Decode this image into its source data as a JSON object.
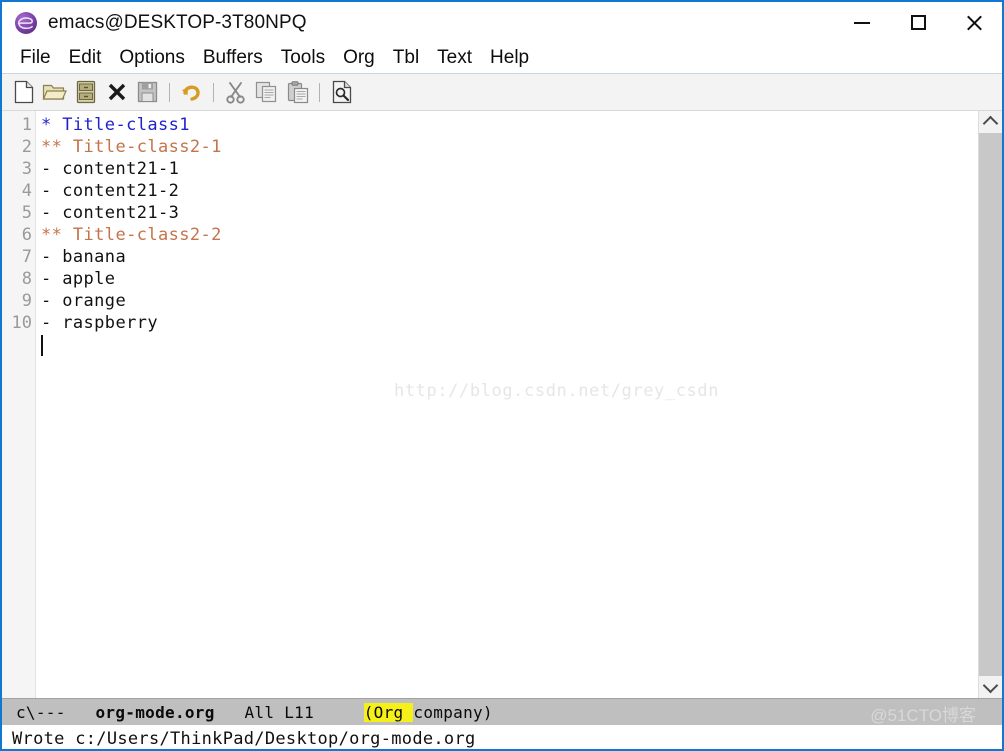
{
  "window": {
    "title": "emacs@DESKTOP-3T80NPQ",
    "app_icon": "emacs-logo-icon",
    "border_color": "#1277d0",
    "controls": {
      "minimize": "–",
      "maximize": "□",
      "close": "✕"
    }
  },
  "menubar": {
    "items": [
      {
        "label": "File"
      },
      {
        "label": "Edit"
      },
      {
        "label": "Options"
      },
      {
        "label": "Buffers"
      },
      {
        "label": "Tools"
      },
      {
        "label": "Org"
      },
      {
        "label": "Tbl"
      },
      {
        "label": "Text"
      },
      {
        "label": "Help"
      }
    ]
  },
  "toolbar": {
    "buttons": [
      {
        "name": "new-file-icon",
        "title": "New File",
        "enabled": true
      },
      {
        "name": "open-file-icon",
        "title": "Open File",
        "enabled": true
      },
      {
        "name": "save-buffer-icon",
        "title": "Save Buffer",
        "enabled": true
      },
      {
        "name": "close-buffer-icon",
        "title": "Close Buffer",
        "enabled": true
      },
      {
        "name": "save-disk-icon",
        "title": "Save",
        "enabled": false
      },
      {
        "name": "separator"
      },
      {
        "name": "undo-icon",
        "title": "Undo",
        "enabled": true
      },
      {
        "name": "separator"
      },
      {
        "name": "cut-icon",
        "title": "Cut",
        "enabled": true
      },
      {
        "name": "copy-icon",
        "title": "Copy",
        "enabled": true
      },
      {
        "name": "paste-icon",
        "title": "Paste",
        "enabled": true
      },
      {
        "name": "separator"
      },
      {
        "name": "search-icon",
        "title": "Search",
        "enabled": true
      }
    ]
  },
  "editor": {
    "line_numbers": [
      "1",
      "2",
      "3",
      "4",
      "5",
      "6",
      "7",
      "8",
      "9",
      "10"
    ],
    "lines": [
      {
        "text": "* Title-class1",
        "style": "h1"
      },
      {
        "text": "** Title-class2-1",
        "style": "h2"
      },
      {
        "text": "- content21-1",
        "style": "body"
      },
      {
        "text": "- content21-2",
        "style": "body"
      },
      {
        "text": "- content21-3",
        "style": "body"
      },
      {
        "text": "** Title-class2-2",
        "style": "h2"
      },
      {
        "text": "- banana",
        "style": "body"
      },
      {
        "text": "- apple",
        "style": "body"
      },
      {
        "text": "- orange",
        "style": "body"
      },
      {
        "text": "- raspberry",
        "style": "body"
      }
    ],
    "colors": {
      "heading1": "#2222cc",
      "heading2": "#c4734a",
      "body": "#111111",
      "line_number": "#9a9a9a",
      "background": "#ffffff"
    },
    "watermark": "http://blog.csdn.net/grey_csdn",
    "cursor_line": 11
  },
  "scrollbar": {
    "up_arrow": "∧",
    "down_arrow": "∨"
  },
  "modeline": {
    "status_flags": "c\\---",
    "buffer_name": "org-mode.org",
    "scroll_position": "All",
    "line_indicator": "L11",
    "major_mode_open": "(Org ",
    "minor_mode": "company)",
    "highlight_color": "#f5ef1a",
    "background": "#bfbfbf"
  },
  "minibuffer": {
    "message": "Wrote c:/Users/ThinkPad/Desktop/org-mode.org"
  },
  "overlay": {
    "corner_watermark": "@51CTO博客"
  }
}
